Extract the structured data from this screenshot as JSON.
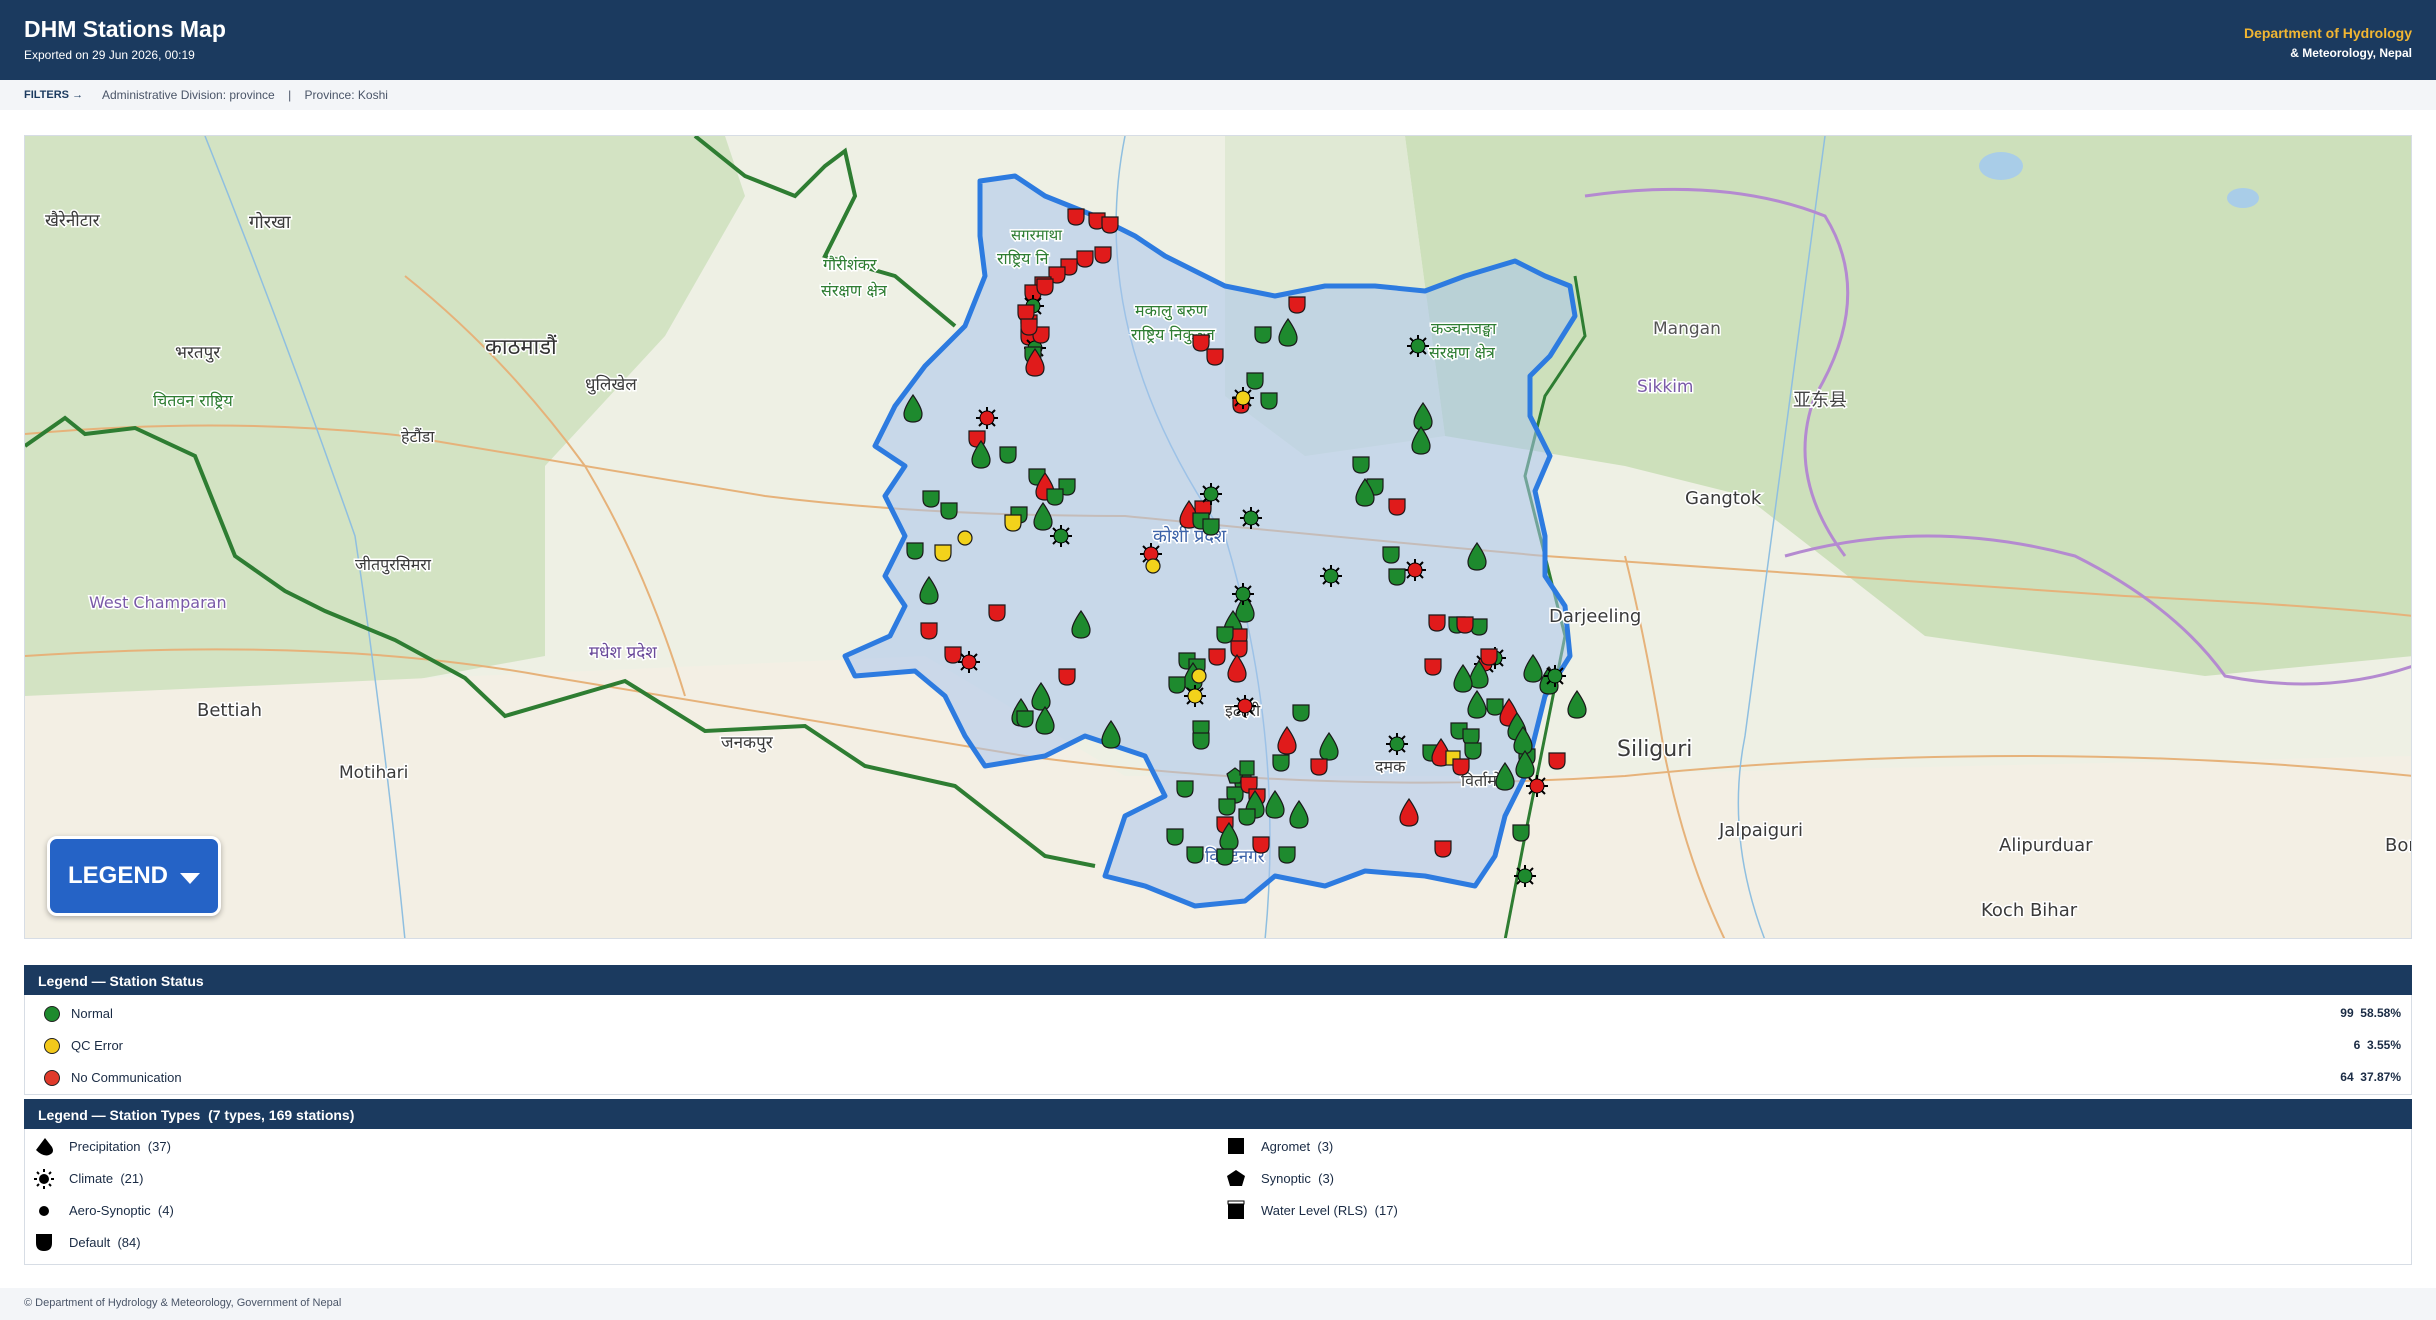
{
  "header": {
    "title": "DHM Stations Map",
    "exported": "Exported on 29 Jun 2026, 00:19",
    "org_line1": "Department of Hydrology",
    "org_line2": "& Meteorology, Nepal"
  },
  "filters": {
    "label": "FILTERS →",
    "division": "Administrative Division: province",
    "separator": "|",
    "province": "Province: Koshi"
  },
  "map": {
    "legend_button": "LEGEND",
    "place_labels": [
      "खैरेनीटार",
      "गोरखा",
      "भरतपुर",
      "काठमाडौं",
      "धुलिखेल",
      "चितवन राष्ट्रिय",
      "हेटौंडा",
      "जीतपुरसिमरा",
      "West Champaran",
      "मधेश प्रदेश",
      "Bettiah",
      "Motihari",
      "जनकपुर",
      "सगरमाथा",
      "राष्ट्रिय नि",
      "गौरीशंकर",
      "संरक्षण क्षेत्र",
      "मकालु बरुण",
      "राष्ट्रिय निकुञ्ज",
      "कञ्चनजङ्घा",
      "संरक्षण क्षेत्र",
      "Mangan",
      "Sikkim",
      "亚东县",
      "Gangtok",
      "कोशी प्रदेश",
      "Darjeeling",
      "Siliguri",
      "Jalpaiguri",
      "Alipurduar",
      "Koch Bihar",
      "विराटनगर",
      "दमक",
      "इटहरी",
      "विर्तामोड",
      "Bon"
    ],
    "colors": {
      "normal": "#1e8a2e",
      "qc_error": "#f2d21b",
      "no_comm": "#e01b1b",
      "province_fill": "#a9c4ec",
      "province_border": "#2d7be0"
    }
  },
  "legend_status": {
    "title": "Legend — Station Status",
    "items": [
      {
        "name": "Normal",
        "count": "99",
        "percent": "58.58%",
        "color": "#1e8a2e"
      },
      {
        "name": "QC Error",
        "count": "6",
        "percent": "3.55%",
        "color": "#f2c81b"
      },
      {
        "name": "No Communication",
        "count": "64",
        "percent": "37.87%",
        "color": "#e03a2b"
      }
    ]
  },
  "legend_types": {
    "title": "Legend — Station Types",
    "subtitle": "(7 types, 169 stations)",
    "items": [
      {
        "name": "Precipitation",
        "count": "(37)",
        "icon": "drop-icon"
      },
      {
        "name": "Agromet",
        "count": "(3)",
        "icon": "square-icon"
      },
      {
        "name": "Climate",
        "count": "(21)",
        "icon": "sun-icon"
      },
      {
        "name": "Synoptic",
        "count": "(3)",
        "icon": "pentagon-icon"
      },
      {
        "name": "Aero-Synoptic",
        "count": "(4)",
        "icon": "dot-icon"
      },
      {
        "name": "Water Level (RLS)",
        "count": "(17)",
        "icon": "gauge-icon"
      },
      {
        "name": "Default",
        "count": "(84)",
        "icon": "shield-icon"
      }
    ]
  },
  "footer": {
    "text": "© Department of Hydrology & Meteorology, Government of Nepal"
  }
}
